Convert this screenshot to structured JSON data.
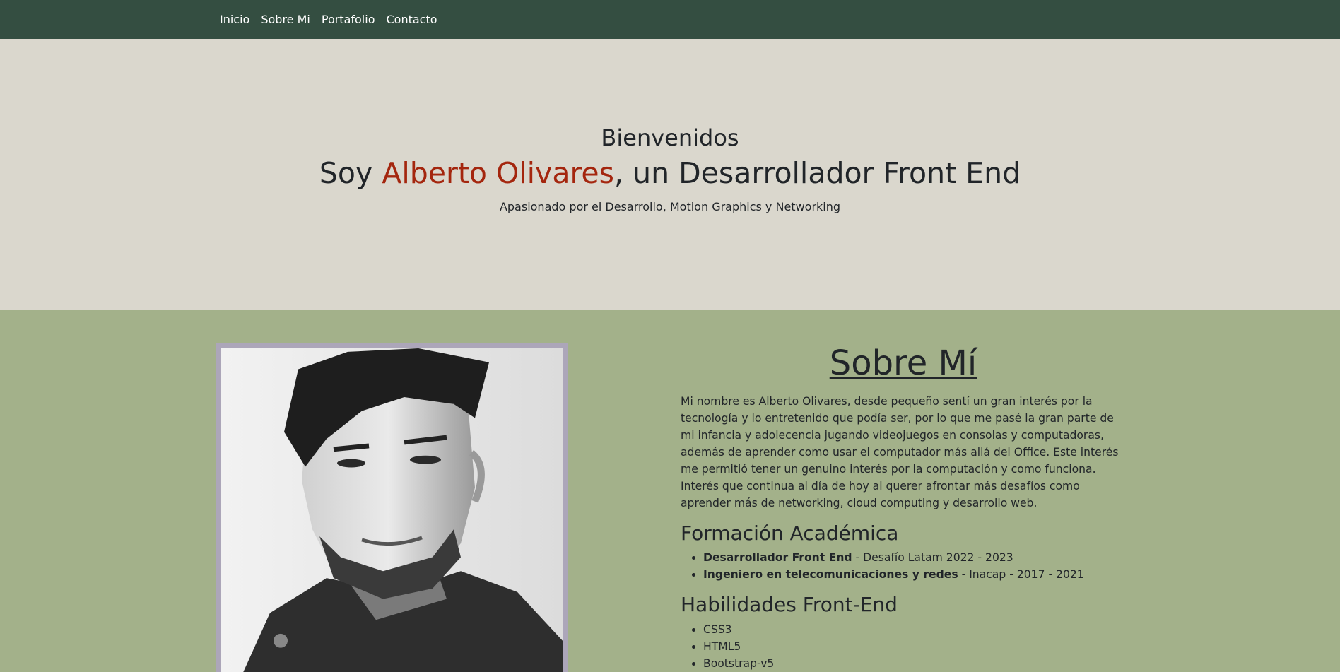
{
  "nav": {
    "items": [
      "Inicio",
      "Sobre Mi",
      "Portafolio",
      "Contacto"
    ]
  },
  "hero": {
    "welcome": "Bienvenidos",
    "headline_prefix": "Soy ",
    "headline_name": "Alberto Olivares",
    "headline_suffix": ", un Desarrollador Front End",
    "tagline": "Apasionado por el Desarrollo, Motion Graphics y Networking"
  },
  "about": {
    "title": "Sobre Mí",
    "paragraph": "Mi nombre es Alberto Olivares, desde pequeño sentí un gran interés por la tecnología y lo entretenido que podía ser, por lo que me pasé la gran parte de mi infancia y adolecencia jugando videojuegos en consolas y computadoras, además de aprender como usar el computador más allá del Office. Este interés me permitió tener un genuino interés por la computación y como funciona. Interés que continua al día de hoy al querer afrontar más desafíos como aprender más de networking, cloud computing y desarrollo web.",
    "education_heading": "Formación Académica",
    "education": [
      {
        "degree": "Desarrollador Front End",
        "detail": " - Desafío Latam 2022 - 2023"
      },
      {
        "degree": "Ingeniero en telecomunicaciones y redes",
        "detail": " - Inacap - 2017 - 2021"
      }
    ],
    "skills_heading": "Habilidades Front-End",
    "skills": [
      "CSS3",
      "HTML5",
      "Bootstrap-v5"
    ]
  },
  "colors": {
    "navbar": "#344e41",
    "hero_bg": "#dad7cd",
    "about_bg": "#a3b18a",
    "accent_name": "#a4260e",
    "photo_border": "#aca6b9"
  }
}
